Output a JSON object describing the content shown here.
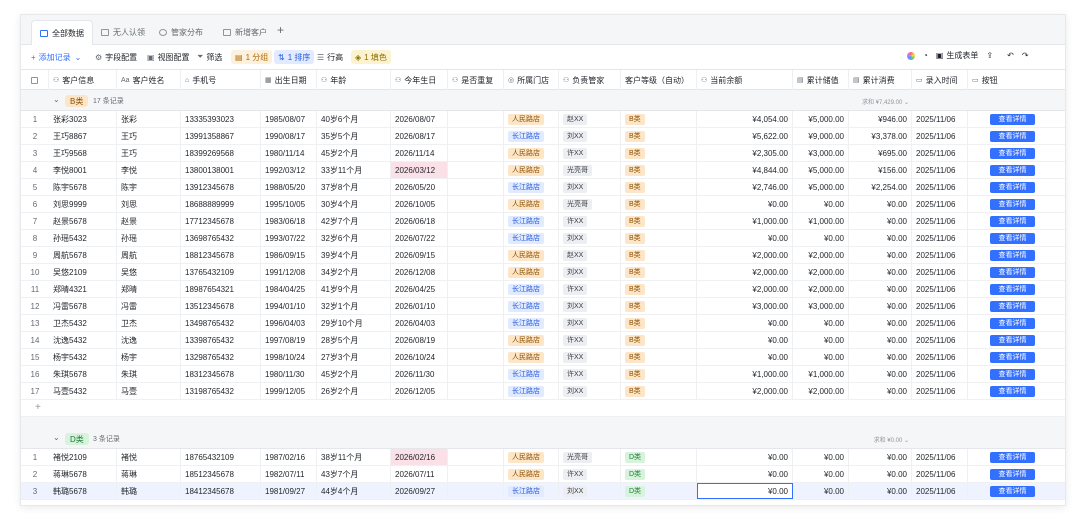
{
  "tabs": [
    {
      "label": "全部数据",
      "active": true
    },
    {
      "label": "无人认领",
      "active": false
    },
    {
      "label": "管家分布",
      "active": false
    },
    {
      "label": "新增客户",
      "active": false
    }
  ],
  "toolbar": {
    "add_record": "添加记录",
    "field_config": "字段配置",
    "view_config": "视图配置",
    "filter": "筛选",
    "group": "1 分组",
    "sort": "1 排序",
    "row_height": "行高",
    "color": "1 填色",
    "generate_form": "生成表单"
  },
  "columns": [
    "客户信息",
    "客户姓名",
    "手机号",
    "出生日期",
    "年龄",
    "今年生日",
    "是否重复",
    "所属门店",
    "负责管家",
    "客户等级（自动）",
    "当前余额",
    "累计储值",
    "累计消费",
    "录入时间",
    "按钮"
  ],
  "groups": [
    {
      "badge": "B类",
      "count": "17 条记录",
      "sum_label": "求和 ¥7,429.00",
      "rows": [
        [
          "1",
          "张彩3023",
          "张彩",
          "13335393023",
          "1985/08/07",
          "40岁6个月",
          "2026/08/07",
          "",
          "人民路店",
          "赵XX",
          "B类",
          "¥4,054.00",
          "¥5,000.00",
          "¥946.00",
          "2025/11/06",
          "查看详情"
        ],
        [
          "2",
          "王巧8867",
          "王巧",
          "13991358867",
          "1990/08/17",
          "35岁5个月",
          "2026/08/17",
          "",
          "长江路店",
          "刘XX",
          "B类",
          "¥5,622.00",
          "¥9,000.00",
          "¥3,378.00",
          "2025/11/06",
          "查看详情"
        ],
        [
          "3",
          "王巧9568",
          "王巧",
          "18399269568",
          "1980/11/14",
          "45岁2个月",
          "2026/11/14",
          "",
          "人民路店",
          "许XX",
          "B类",
          "¥2,305.00",
          "¥3,000.00",
          "¥695.00",
          "2025/11/06",
          "查看详情"
        ],
        [
          "4",
          "李悦8001",
          "李悦",
          "13800138001",
          "1992/03/12",
          "33岁11个月",
          "2026/03/12",
          "",
          "人民路店",
          "光亮哥",
          "B类",
          "¥4,844.00",
          "¥5,000.00",
          "¥156.00",
          "2025/11/06",
          "查看详情"
        ],
        [
          "5",
          "陈宇5678",
          "陈宇",
          "13912345678",
          "1988/05/20",
          "37岁8个月",
          "2026/05/20",
          "",
          "长江路店",
          "刘XX",
          "B类",
          "¥2,746.00",
          "¥5,000.00",
          "¥2,254.00",
          "2025/11/06",
          "查看详情"
        ],
        [
          "6",
          "刘思9999",
          "刘思",
          "18688889999",
          "1995/10/05",
          "30岁4个月",
          "2026/10/05",
          "",
          "人民路店",
          "光亮哥",
          "B类",
          "¥0.00",
          "¥0.00",
          "¥0.00",
          "2025/11/06",
          "查看详情"
        ],
        [
          "7",
          "赵景5678",
          "赵景",
          "17712345678",
          "1983/06/18",
          "42岁7个月",
          "2026/06/18",
          "",
          "长江路店",
          "许XX",
          "B类",
          "¥1,000.00",
          "¥1,000.00",
          "¥0.00",
          "2025/11/06",
          "查看详情"
        ],
        [
          "8",
          "孙瑶5432",
          "孙瑶",
          "13698765432",
          "1993/07/22",
          "32岁6个月",
          "2026/07/22",
          "",
          "长江路店",
          "刘XX",
          "B类",
          "¥0.00",
          "¥0.00",
          "¥0.00",
          "2025/11/06",
          "查看详情"
        ],
        [
          "9",
          "周航5678",
          "周航",
          "18812345678",
          "1986/09/15",
          "39岁4个月",
          "2026/09/15",
          "",
          "人民路店",
          "赵XX",
          "B类",
          "¥2,000.00",
          "¥2,000.00",
          "¥0.00",
          "2025/11/06",
          "查看详情"
        ],
        [
          "10",
          "吴悠2109",
          "吴悠",
          "13765432109",
          "1991/12/08",
          "34岁2个月",
          "2026/12/08",
          "",
          "人民路店",
          "刘XX",
          "B类",
          "¥2,000.00",
          "¥2,000.00",
          "¥0.00",
          "2025/11/06",
          "查看详情"
        ],
        [
          "11",
          "郑晴4321",
          "郑晴",
          "18987654321",
          "1984/04/25",
          "41岁9个月",
          "2026/04/25",
          "",
          "长江路店",
          "许XX",
          "B类",
          "¥2,000.00",
          "¥2,000.00",
          "¥0.00",
          "2025/11/06",
          "查看详情"
        ],
        [
          "12",
          "冯雷5678",
          "冯雷",
          "13512345678",
          "1994/01/10",
          "32岁1个月",
          "2026/01/10",
          "",
          "长江路店",
          "刘XX",
          "B类",
          "¥3,000.00",
          "¥3,000.00",
          "¥0.00",
          "2025/11/06",
          "查看详情"
        ],
        [
          "13",
          "卫杰5432",
          "卫杰",
          "13498765432",
          "1996/04/03",
          "29岁10个月",
          "2026/04/03",
          "",
          "长江路店",
          "刘XX",
          "B类",
          "¥0.00",
          "¥0.00",
          "¥0.00",
          "2025/11/06",
          "查看详情"
        ],
        [
          "14",
          "沈逸5432",
          "沈逸",
          "13398765432",
          "1997/08/19",
          "28岁5个月",
          "2026/08/19",
          "",
          "人民路店",
          "许XX",
          "B类",
          "¥0.00",
          "¥0.00",
          "¥0.00",
          "2025/11/06",
          "查看详情"
        ],
        [
          "15",
          "杨宇5432",
          "杨宇",
          "13298765432",
          "1998/10/24",
          "27岁3个月",
          "2026/10/24",
          "",
          "人民路店",
          "许XX",
          "B类",
          "¥0.00",
          "¥0.00",
          "¥0.00",
          "2025/11/06",
          "查看详情"
        ],
        [
          "16",
          "朱琪5678",
          "朱琪",
          "18312345678",
          "1980/11/30",
          "45岁2个月",
          "2026/11/30",
          "",
          "长江路店",
          "许XX",
          "B类",
          "¥1,000.00",
          "¥1,000.00",
          "¥0.00",
          "2025/11/06",
          "查看详情"
        ],
        [
          "17",
          "马壹5432",
          "马壹",
          "13198765432",
          "1999/12/05",
          "26岁2个月",
          "2026/12/05",
          "",
          "长江路店",
          "刘XX",
          "B类",
          "¥2,000.00",
          "¥2,000.00",
          "¥0.00",
          "2025/11/06",
          "查看详情"
        ]
      ]
    },
    {
      "badge": "D类",
      "count": "3 条记录",
      "sum_label": "求和 ¥0.00",
      "rows": [
        [
          "1",
          "褚悦2109",
          "褚悦",
          "18765432109",
          "1987/02/16",
          "38岁11个月",
          "2026/02/16",
          "",
          "人民路店",
          "光亮哥",
          "D类",
          "¥0.00",
          "¥0.00",
          "¥0.00",
          "2025/11/06",
          "查看详情"
        ],
        [
          "2",
          "蒋琳5678",
          "蒋琳",
          "18512345678",
          "1982/07/11",
          "43岁7个月",
          "2026/07/11",
          "",
          "人民路店",
          "许XX",
          "D类",
          "¥0.00",
          "¥0.00",
          "¥0.00",
          "2025/11/06",
          "查看详情"
        ],
        [
          "3",
          "韩璐5678",
          "韩璐",
          "18412345678",
          "1981/09/27",
          "44岁4个月",
          "2026/09/27",
          "",
          "长江路店",
          "刘XX",
          "D类",
          "¥0.00",
          "¥0.00",
          "¥0.00",
          "2025/11/06",
          "查看详情"
        ]
      ]
    }
  ],
  "highlight_birthday": [
    "2026/03/12",
    "2026/02/16"
  ],
  "colors": {
    "accent": "#3370ff",
    "pink_highlight": "#fbe0e8"
  }
}
